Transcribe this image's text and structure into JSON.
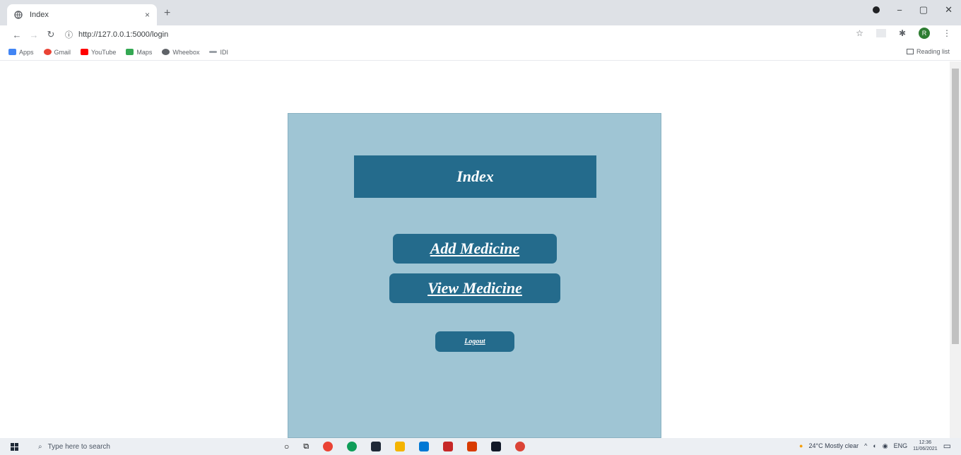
{
  "browser": {
    "tab_title": "Index",
    "tab_close": "×",
    "new_tab": "+",
    "url": "http://127.0.0.1:5000/login",
    "win_minimize": "−",
    "win_maximize": "▢",
    "win_close": "✕",
    "avatar_letter": "R"
  },
  "bookmarks": [
    {
      "label": "Apps",
      "color": "#4285f4"
    },
    {
      "label": "Gmail",
      "color": "#ea4335"
    },
    {
      "label": "YouTube",
      "color": "#ff0000"
    },
    {
      "label": "Maps",
      "color": "#34a853"
    },
    {
      "label": "Wheebox",
      "color": "#5f6368"
    },
    {
      "label": "IDI",
      "color": "#9aa0a6"
    }
  ],
  "reading_list": "Reading list",
  "page": {
    "heading": "Index",
    "add_medicine": "Add Medicine",
    "view_medicine": "View Medicine",
    "logout": "Logout"
  },
  "taskbar": {
    "search_placeholder": "Type here to search",
    "weather": "24°C  Mostly clear",
    "lang": "ENG",
    "time": "12:36",
    "date": "11/06/2021"
  },
  "colors": {
    "panel_bg": "#9fc5d4",
    "accent": "#246b8c"
  }
}
